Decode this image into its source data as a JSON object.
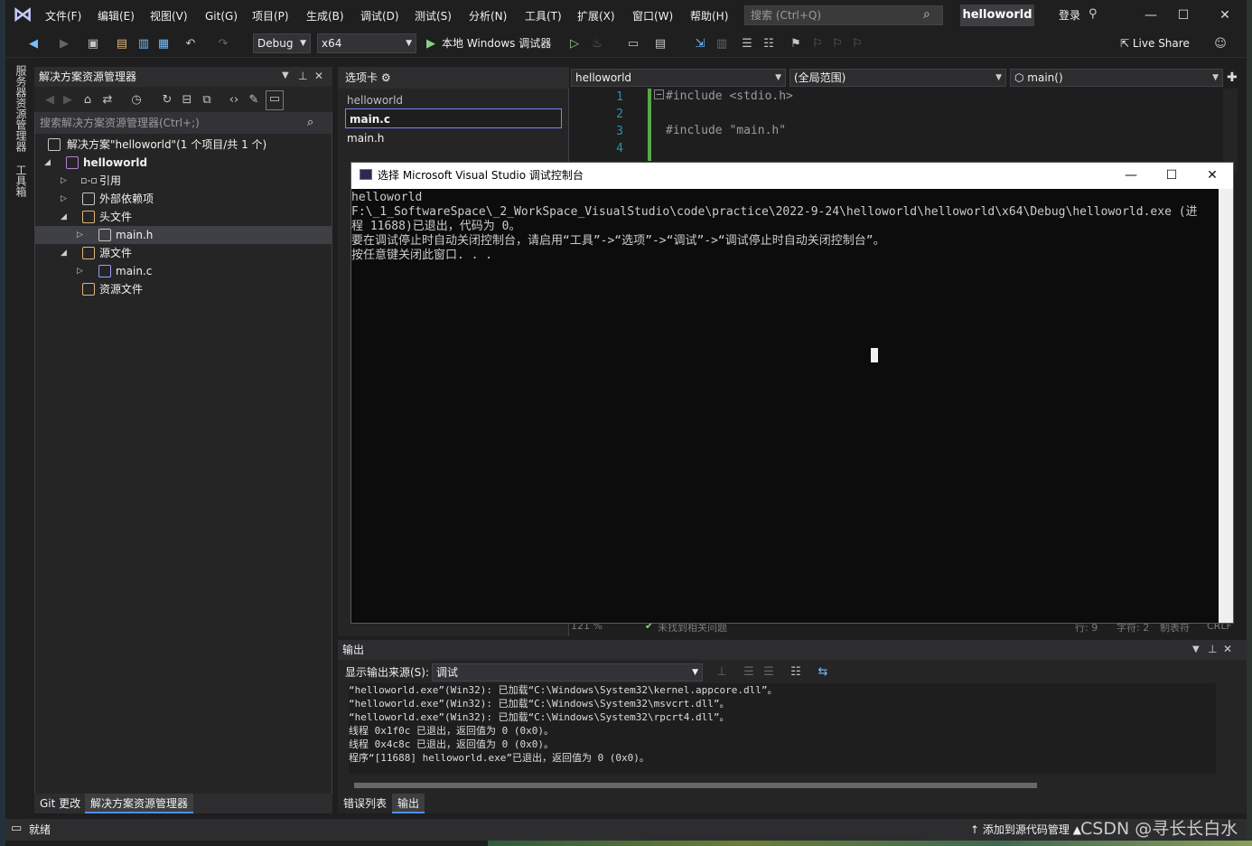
{
  "menubar": {
    "items": [
      "文件(F)",
      "编辑(E)",
      "视图(V)",
      "Git(G)",
      "项目(P)",
      "生成(B)",
      "调试(D)",
      "测试(S)",
      "分析(N)",
      "工具(T)",
      "扩展(X)",
      "窗口(W)",
      "帮助(H)"
    ],
    "search_placeholder": "搜索 (Ctrl+Q)",
    "solution_name": "helloworld",
    "login": "登录"
  },
  "toolbar": {
    "config": "Debug",
    "platform": "x64",
    "run_label": "本地 Windows 调试器",
    "live_share": "Live Share"
  },
  "left_strip": {
    "tab1": "服务器资源管理器",
    "tab2": "工具箱"
  },
  "solution_explorer": {
    "title": "解决方案资源管理器",
    "search_placeholder": "搜索解决方案资源管理器(Ctrl+;)",
    "tree": {
      "solution": "解决方案\"helloworld\"(1 个项目/共 1 个)",
      "project": "helloworld",
      "references": "引用",
      "external_deps": "外部依赖项",
      "headers": "头文件",
      "main_h": "main.h",
      "sources": "源文件",
      "main_c": "main.c",
      "resources": "资源文件"
    },
    "bottom_tabs": [
      "Git 更改",
      "解决方案资源管理器"
    ]
  },
  "editor": {
    "tabs_header": "选项卡",
    "tab_project": "helloworld",
    "tab_main_c": "main.c",
    "tab_main_h": "main.h",
    "nav_project": "helloworld",
    "nav_scope": "(全局范围)",
    "nav_member": "main()",
    "line_numbers": [
      "1",
      "2",
      "3",
      "4"
    ],
    "code": [
      "#include <stdio.h>",
      "#include \"main.h\""
    ],
    "status_zoom": "121 %",
    "status_issues": "未找到相关问题",
    "status_line": "行: 9",
    "status_char": "字符: 2",
    "status_tabs": "制表符",
    "status_eol": "CRLF"
  },
  "console": {
    "title": "选择 Microsoft Visual Studio 调试控制台",
    "lines": [
      "helloworld",
      "",
      "F:\\_1_SoftwareSpace\\_2_WorkSpace_VisualStudio\\code\\practice\\2022-9-24\\helloworld\\helloworld\\x64\\Debug\\helloworld.exe (进",
      "程 11688)已退出，代码为 0。",
      "要在调试停止时自动关闭控制台，请启用“工具”->“选项”->“调试”->“调试停止时自动关闭控制台”。",
      "按任意键关闭此窗口. . ."
    ]
  },
  "output": {
    "title": "输出",
    "source_label": "显示输出来源(S):",
    "source_value": "调试",
    "lines": [
      "“helloworld.exe”(Win32): 已加载“C:\\Windows\\System32\\kernel.appcore.dll”。",
      "“helloworld.exe”(Win32): 已加载“C:\\Windows\\System32\\msvcrt.dll”。",
      "“helloworld.exe”(Win32): 已加载“C:\\Windows\\System32\\rpcrt4.dll”。",
      "线程 0x1f0c 已退出，返回值为 0 (0x0)。",
      "线程 0x4c8c 已退出，返回值为 0 (0x0)。",
      "程序“[11688] helloworld.exe”已退出，返回值为 0 (0x0)。"
    ],
    "bottom_tabs": [
      "错误列表",
      "输出"
    ]
  },
  "statusbar": {
    "ready": "就绪",
    "source_control": "添加到源代码管理",
    "watermark": "CSDN @寻长长白水"
  }
}
